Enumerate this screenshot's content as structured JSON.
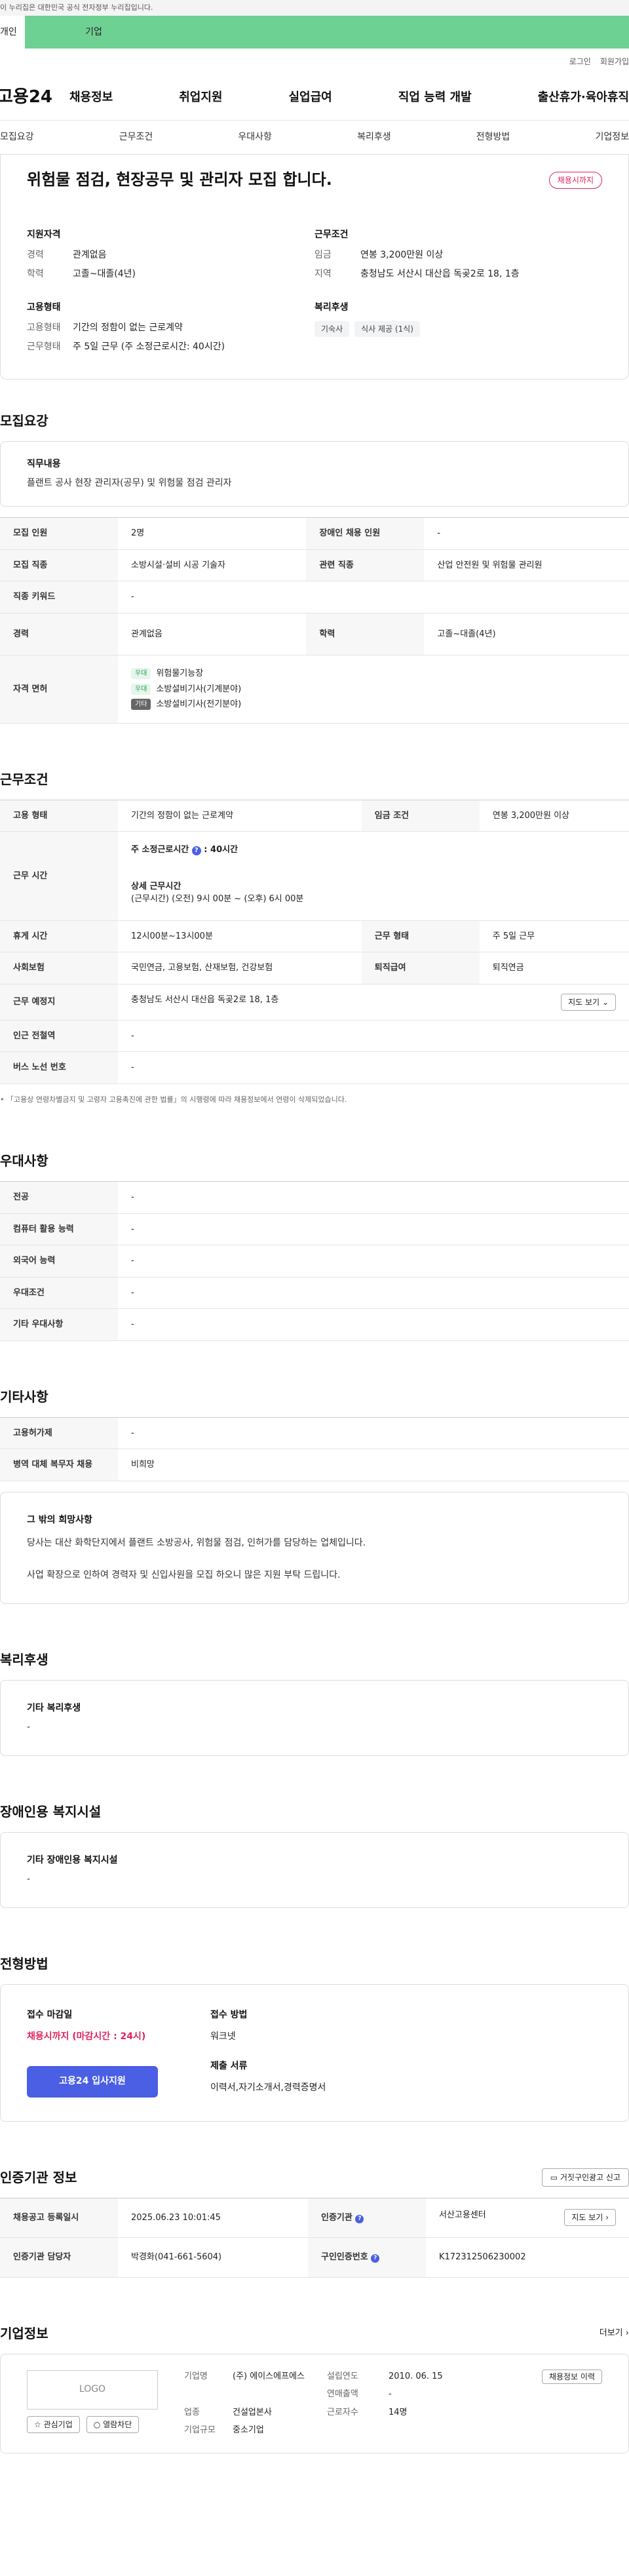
{
  "top_notice": "이 누리집은 대한민국 공식 전자정부 누리집입니다.",
  "green_tabs": [
    "개인",
    "기업"
  ],
  "util": [
    "로그인",
    "회원가입"
  ],
  "logo": "고용24",
  "gnb": [
    "채용정보",
    "취업지원",
    "실업급여",
    "직업 능력 개발",
    "출산휴가·육아휴직"
  ],
  "anchors": [
    "모집요강",
    "근무조건",
    "우대사항",
    "복리후생",
    "전형방법",
    "기업정보"
  ],
  "hero": {
    "title": "위험물 점검, 현장공무 및 관리자 모집 합니다.",
    "badge": "채용시까지",
    "qual_title": "지원자격",
    "qual": [
      {
        "k": "경력",
        "v": "관계없음"
      },
      {
        "k": "학력",
        "v": "고졸~대졸(4년)"
      }
    ],
    "type_title": "고용형태",
    "type": [
      {
        "k": "고용형태",
        "v": "기간의 정함이 없는 근로계약"
      },
      {
        "k": "근무형태",
        "v": "주 5일 근무 (주 소정근로시간: 40시간)"
      }
    ],
    "cond_title": "근무조건",
    "cond": [
      {
        "k": "임금",
        "v": "연봉 3,200만원 이상"
      },
      {
        "k": "지역",
        "v": "충청남도 서산시 대산읍 독곶2로 18, 1층"
      }
    ],
    "welfare_title": "복리후생",
    "welfare_chips": [
      "기숙사",
      "식사 제공 (1식)"
    ]
  },
  "recruit": {
    "title": "모집요강",
    "duty_label": "직무내용",
    "duty_text": "플랜트 공사 현장 관리자(공무) 및 위험물 점검 관리자",
    "rows": [
      {
        "k1": "모집 인원",
        "v1": "2명",
        "k2": "장애인 채용 인원",
        "v2": "-"
      },
      {
        "k1": "모집 직종",
        "v1": "소방시설·설비 시공 기술자",
        "k2": "관련 직종",
        "v2": "산업 안전원 및 위험물 관리원"
      }
    ],
    "keyword_label": "직종 키워드",
    "keyword_value": "-",
    "career_label": "경력",
    "career_value": "관계없음",
    "edu_label": "학력",
    "edu_value": "고졸~대졸(4년)",
    "license_label": "자격 면허",
    "licenses": [
      {
        "tag": "우대",
        "name": "위험물기능장"
      },
      {
        "tag": "우대",
        "name": "소방설비기사(기계분야)"
      },
      {
        "tag": "기타",
        "name": "소방설비기사(전기분야)"
      }
    ]
  },
  "work": {
    "title": "근무조건",
    "emp_type_label": "고용 형태",
    "emp_type": "기간의 정함이 없는 근로계약",
    "wage_label": "임금 조건",
    "wage": "연봉 3,200만원 이상",
    "hours_label": "근무 시간",
    "weekly_label": "주 소정근로시간",
    "weekly_value": "40시간",
    "detail_label": "상세 근무시간",
    "detail_value": "(근무시간) (오전) 9시 00분 ~ (오후) 6시 00분",
    "rest_label": "휴게 시간",
    "rest": "12시00분~13시00분",
    "shift_label": "근무 형태",
    "shift": "주 5일 근무",
    "insurance_label": "사회보험",
    "insurance": "국민연금, 고용보험, 산재보험, 건강보험",
    "retire_label": "퇴직급여",
    "retire": "퇴직연금",
    "place_label": "근무 예정지",
    "place": "충청남도 서산시 대산읍 독곶2로 18, 1층",
    "map_btn": "지도 보기",
    "station_label": "인근 전철역",
    "station": "-",
    "bus_label": "버스 노선 번호",
    "bus": "-",
    "note": "「고용상 연령차별금지 및 고령자 고용촉진에 관한 법률」의 시행령에 따라 채용정보에서 연령이 삭제되었습니다."
  },
  "pref": {
    "title": "우대사항",
    "rows": [
      {
        "k": "전공",
        "v": "-"
      },
      {
        "k": "컴퓨터 활용 능력",
        "v": "-"
      },
      {
        "k": "외국어 능력",
        "v": "-"
      },
      {
        "k": "우대조건",
        "v": "-"
      },
      {
        "k": "기타 우대사항",
        "v": "-"
      }
    ]
  },
  "etc": {
    "title": "기타사항",
    "rows": [
      {
        "k": "고용허가제",
        "v": "-"
      },
      {
        "k": "병역 대체 복무자 채용",
        "v": "비희망"
      }
    ],
    "wish_label": "그 밖의 희망사항",
    "wish_line1": "당사는 대산 화학단지에서 플랜트 소방공사, 위험물 점검, 인허가를 담당하는 업체입니다.",
    "wish_line2": "사업 확장으로 인하여 경력자 및 신입사원을 모집 하오니 많은 지원 부탁 드립니다."
  },
  "welfare": {
    "title": "복리후생",
    "label": "기타 복리후생",
    "value": "-"
  },
  "disabled": {
    "title": "장애인용 복지시설",
    "label": "기타 장애인용 복지시설",
    "value": "-"
  },
  "apply": {
    "title": "전형방법",
    "deadline_label": "접수 마감일",
    "deadline": "채용시까지 (마감시간 : 24시)",
    "btn": "고용24 입사지원",
    "method_label": "접수 방법",
    "method": "워크넷",
    "docs_label": "제출 서류",
    "docs": "이력서,자기소개서,경력증명서"
  },
  "agency": {
    "title": "인증기관 정보",
    "report_btn": "거짓구인광고 신고",
    "reg_label": "채용공고 등록일시",
    "reg": "2025.06.23 10:01:45",
    "org_label": "인증기관",
    "org": "서산고용센터",
    "route_btn": "지도 보기",
    "manager_label": "인증기관 담당자",
    "manager": "박경화(041-661-5604)",
    "num_label": "구인인증번호",
    "num": "K172312506230002"
  },
  "company": {
    "title": "기업정보",
    "more": "더보기",
    "logo": "LOGO",
    "fav_btn": "관심기업",
    "block_btn": "열람차단",
    "name_label": "기업명",
    "name": "(주) 에이스에프에스",
    "found_label": "설립연도",
    "found": "2010. 06. 15",
    "sales_label": "연매출액",
    "sales": "-",
    "industry_label": "업종",
    "industry": "건설업본사",
    "staff_label": "근로자수",
    "staff": "14명",
    "size_label": "기업규모",
    "size": "중소기업",
    "history_btn": "채용정보 이력"
  }
}
